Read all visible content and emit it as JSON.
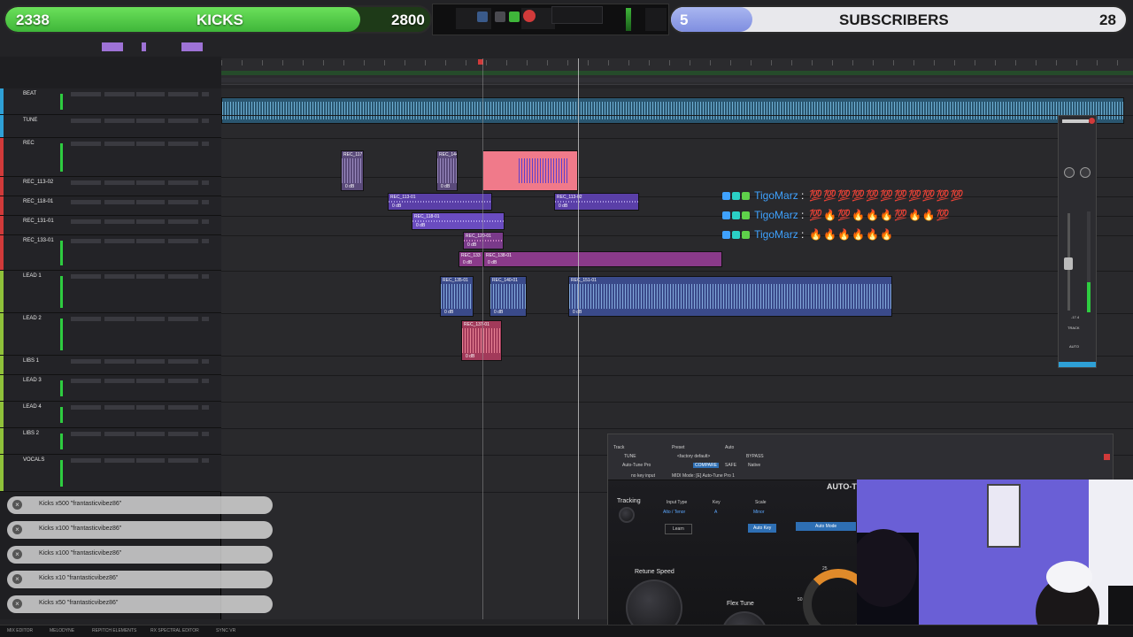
{
  "overlay": {
    "kicks_goal": {
      "count": "2338",
      "label": "KICKS",
      "target": "2800",
      "progress": 0.835
    },
    "subs_goal": {
      "count": "5",
      "label": "SUBSCRIBERS",
      "target": "28",
      "progress": 0.179
    }
  },
  "tracks": [
    {
      "name": "BEAT",
      "color": "#2ea0d6"
    },
    {
      "name": "TUNE",
      "color": "#2ea0d6"
    },
    {
      "name": "REC",
      "color": "#d13a3a"
    },
    {
      "name": "REC_113-02",
      "color": "#d13a3a"
    },
    {
      "name": "REC_118-01",
      "color": "#d13a3a"
    },
    {
      "name": "REC_131-01",
      "color": "#d13a3a"
    },
    {
      "name": "REC_133-01",
      "color": "#d13a3a"
    },
    {
      "name": "LEAD 1",
      "color": "#8fc13a"
    },
    {
      "name": "LEAD 2",
      "color": "#8fc13a"
    },
    {
      "name": "LIBS 1",
      "color": "#8fc13a"
    },
    {
      "name": "LEAD 3",
      "color": "#8fc13a"
    },
    {
      "name": "LEAD 4",
      "color": "#8fc13a"
    },
    {
      "name": "LIBS 2",
      "color": "#8fc13a"
    },
    {
      "name": "VOCALS",
      "color": "#8fc13a"
    }
  ],
  "clips": [
    {
      "label": "REC_117",
      "db": "0 dB"
    },
    {
      "label": "REC_144",
      "db": "0 dB"
    },
    {
      "label": "REC_113-01",
      "db": "0 dB"
    },
    {
      "label": "REC_113-02",
      "db": "0 dB"
    },
    {
      "label": "REC_118-01",
      "db": "0 dB"
    },
    {
      "label": "REC_120-01",
      "db": "0 dB"
    },
    {
      "label": "REC_133",
      "db": "0 dB"
    },
    {
      "label": "REC_138-01",
      "db": "0 dB"
    },
    {
      "label": "REC_135-01",
      "db": "0 dB"
    },
    {
      "label": "REC_140-01",
      "db": "0 dB"
    },
    {
      "label": "REC_151-01",
      "db": "0 dB"
    },
    {
      "label": "REC_137-01",
      "db": "0 dB"
    }
  ],
  "chat": [
    {
      "user": "TigoMarz",
      "message": "💯💯💯💯💯💯💯💯💯💯💯"
    },
    {
      "user": "TigoMarz",
      "message": "💯🔥💯🔥🔥🔥💯🔥🔥💯"
    },
    {
      "user": "TigoMarz",
      "message": "🔥🔥🔥🔥🔥🔥"
    }
  ],
  "donations": [
    {
      "text": "Kicks x500 \"frantasticvibez86\""
    },
    {
      "text": "Kicks x100 \"frantasticvibez86\""
    },
    {
      "text": "Kicks x100 \"frantasticvibez86\""
    },
    {
      "text": "Kicks x10 \"frantasticvibez86\""
    },
    {
      "text": "Kicks x50 \"frantasticvibez86\""
    }
  ],
  "plugin": {
    "track_label": "Track",
    "preset_label": "Preset",
    "auto_label": "Auto",
    "track_value": "TUNE",
    "preset_value": "<factory default>",
    "compare": "COMPARE",
    "bypass": "BYPASS",
    "safe": "SAFE",
    "native": "Native",
    "plugin_name": "Auto-Tune Pro",
    "key_input": "no key input",
    "midi_mode": "MIDI Mode: [E] Auto-Tune Pro 1",
    "title": "AUTO-TU",
    "tracking_label": "Tracking",
    "input_type_label": "Input Type",
    "input_type_value": "Alto / Tenor",
    "key_label": "Key",
    "key_value": "A",
    "scale_label": "Scale",
    "scale_value": "Minor",
    "learn": "Learn",
    "auto_key": "Auto Key",
    "auto_mode": "Auto Mode",
    "retune_speed_label": "Retune Speed",
    "flex_tune_label": "Flex Tune",
    "retune_scale": "25",
    "retune_scale_2": "50"
  },
  "mixer_strip": {
    "track_label": "TRACK",
    "auto_label": "AUTO",
    "level": "-17.4",
    "level_2": "-180"
  },
  "bottom_tabs": [
    "MIX EDITOR",
    "MELODYNE",
    "REPITCH ELEMENTS",
    "RX SPECTRAL EDITOR",
    "SYNC VR"
  ],
  "colors": {
    "accent_green": "#3fb63a",
    "accent_purple": "#8a60d4",
    "record_red": "#d13a3a"
  }
}
